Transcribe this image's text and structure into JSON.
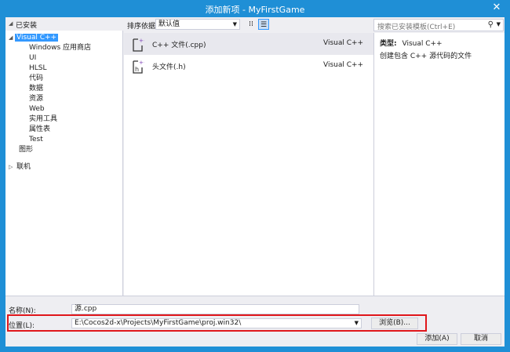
{
  "window": {
    "title": "添加新项 - MyFirstGame",
    "close": "✕"
  },
  "tree": {
    "header": "已安装",
    "items": [
      {
        "label": "Visual C++",
        "level": 1,
        "expanded": true,
        "selected": true
      },
      {
        "label": "Windows 应用商店",
        "level": 2
      },
      {
        "label": "UI",
        "level": 2
      },
      {
        "label": "HLSL",
        "level": 2
      },
      {
        "label": "代码",
        "level": 2
      },
      {
        "label": "数据",
        "level": 2
      },
      {
        "label": "资源",
        "level": 2
      },
      {
        "label": "Web",
        "level": 2
      },
      {
        "label": "实用工具",
        "level": 2
      },
      {
        "label": "属性表",
        "level": 2
      },
      {
        "label": "Test",
        "level": 2
      },
      {
        "label": "图形",
        "level": 1
      }
    ],
    "online": "联机"
  },
  "toolbar": {
    "sort_label": "排序依据:",
    "sort_value": "默认值"
  },
  "templates": [
    {
      "name": "C++ 文件(.cpp)",
      "type": "Visual C++",
      "icon": "cpp-file-icon",
      "selected": true
    },
    {
      "name": "头文件(.h)",
      "type": "Visual C++",
      "icon": "header-file-icon",
      "selected": false
    }
  ],
  "search": {
    "placeholder": "搜索已安装模板(Ctrl+E)"
  },
  "details": {
    "type_label": "类型:",
    "type_value": "Visual C++",
    "description": "创建包含 C++ 源代码的文件"
  },
  "form": {
    "name_label": "名称(N):",
    "name_value": "源.cpp",
    "location_label": "位置(L):",
    "location_value": "E:\\Cocos2d-x\\Projects\\MyFirstGame\\proj.win32\\",
    "browse_label": "浏览(B)...",
    "add_label": "添加(A)",
    "cancel_label": "取消"
  },
  "colors": {
    "titlebar": "#1f8fd6",
    "selection": "#3399ff",
    "highlight": "#e0161b"
  }
}
